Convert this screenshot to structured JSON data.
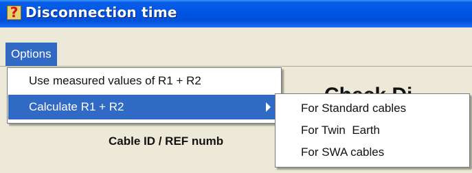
{
  "window": {
    "icon": "question-mark-app-icon",
    "icon_glyph": "?",
    "title": "Disconnection time"
  },
  "menubar": {
    "options_label": "Options"
  },
  "form": {
    "heading": "Check Di",
    "cable_label": "Cable ID / REF numb"
  },
  "options_menu": {
    "items": [
      {
        "label": "Use measured values of R1 + R2"
      },
      {
        "label": "Calculate R1 + R2",
        "highlighted": true,
        "has_submenu": true
      }
    ]
  },
  "calculate_submenu": {
    "items": [
      {
        "label": "For Standard cables"
      },
      {
        "label": "For Twin  Earth"
      },
      {
        "label": "For SWA cables"
      }
    ]
  },
  "colors": {
    "titlebar": "#0054e3",
    "menu_highlight": "#316ac5",
    "window_face": "#ece9d8"
  }
}
